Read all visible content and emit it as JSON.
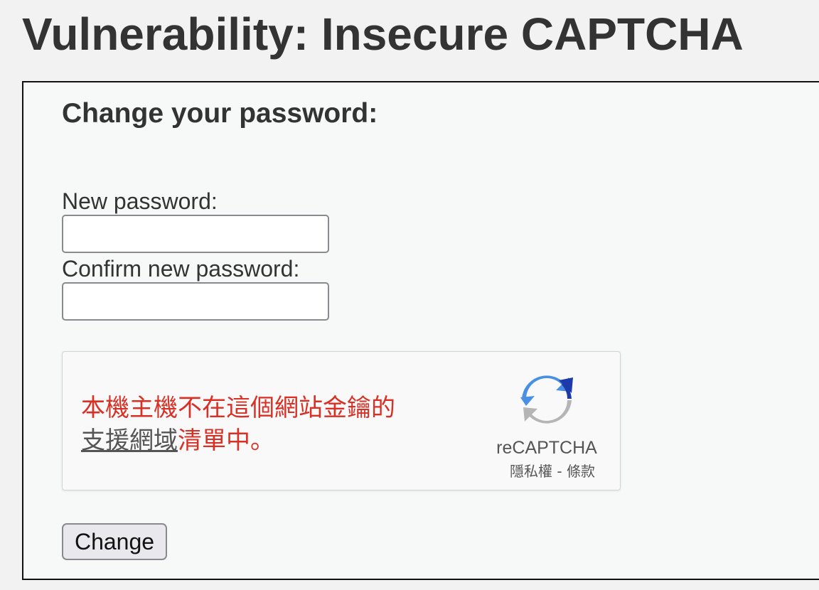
{
  "page": {
    "title": "Vulnerability: Insecure CAPTCHA"
  },
  "form": {
    "heading": "Change your password:",
    "new_password": {
      "label": "New password:",
      "value": "",
      "placeholder": ""
    },
    "confirm_password": {
      "label": "Confirm new password:",
      "value": "",
      "placeholder": ""
    },
    "submit_label": "Change"
  },
  "recaptcha": {
    "error_part1": "本機主機不在這個網站金鑰的",
    "error_link": "支援網域",
    "error_part2": "清單中。",
    "brand": "reCAPTCHA",
    "privacy_label": "隱私權",
    "separator": " - ",
    "terms_label": "條款",
    "logo_icon": "recaptcha-logo-icon",
    "error_color": "#d93025"
  }
}
